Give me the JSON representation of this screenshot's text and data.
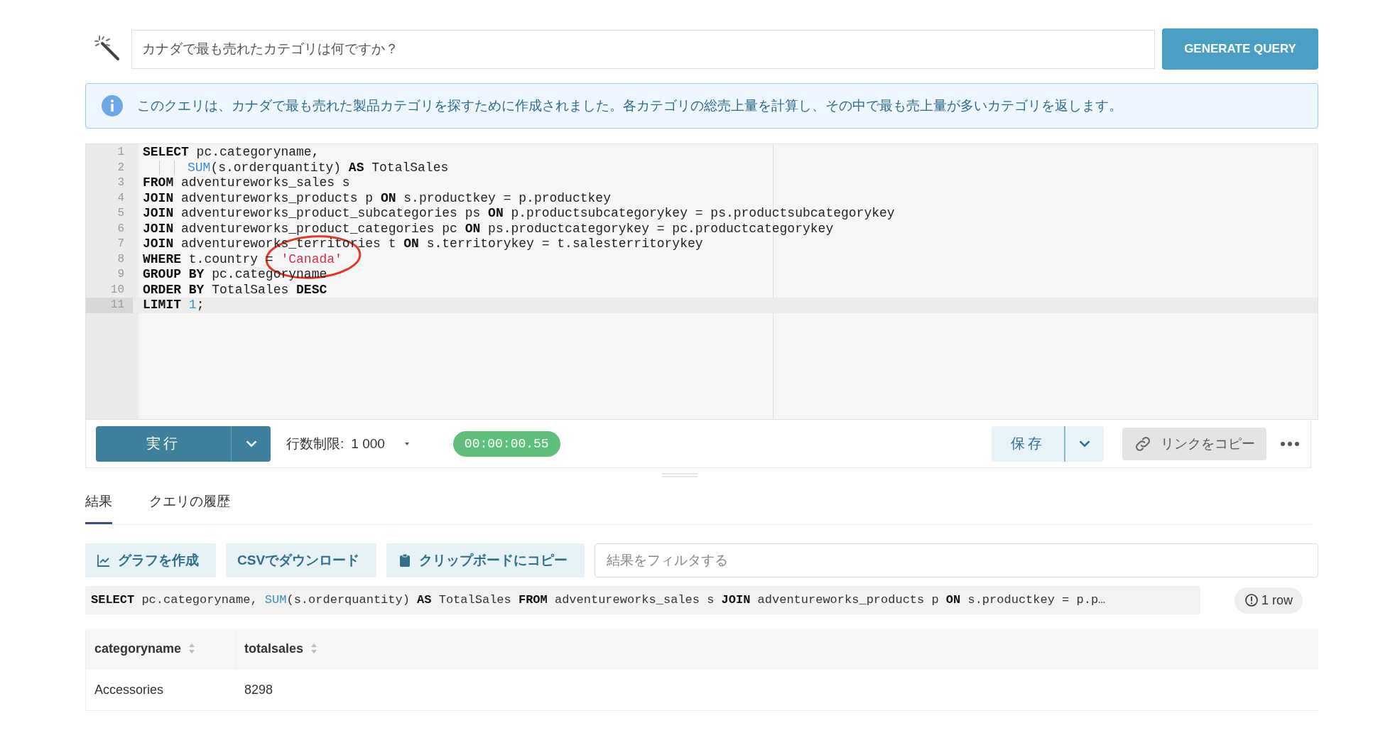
{
  "prompt": {
    "value": "カナダで最も売れたカテゴリは何ですか？",
    "button": "GENERATE QUERY"
  },
  "info": "このクエリは、カナダで最も売れた製品カテゴリを探すために作成されました。各カテゴリの総売上量を計算し、その中で最も売上量が多いカテゴリを返します。",
  "editor": {
    "lines": [
      {
        "number": "1",
        "active": false,
        "indented": false,
        "tokens": [
          {
            "kind": "keyword",
            "text": "SELECT"
          },
          {
            "kind": "plain",
            "text": " pc.categoryname,"
          }
        ]
      },
      {
        "number": "2",
        "active": false,
        "indented": true,
        "tokens": [
          {
            "kind": "function",
            "text": "SUM"
          },
          {
            "kind": "plain",
            "text": "(s.orderquantity) "
          },
          {
            "kind": "keyword",
            "text": "AS"
          },
          {
            "kind": "plain",
            "text": " TotalSales"
          }
        ]
      },
      {
        "number": "3",
        "active": false,
        "indented": false,
        "tokens": [
          {
            "kind": "keyword",
            "text": "FROM"
          },
          {
            "kind": "plain",
            "text": " adventureworks_sales s"
          }
        ]
      },
      {
        "number": "4",
        "active": false,
        "indented": false,
        "tokens": [
          {
            "kind": "keyword",
            "text": "JOIN"
          },
          {
            "kind": "plain",
            "text": " adventureworks_products p "
          },
          {
            "kind": "keyword",
            "text": "ON"
          },
          {
            "kind": "plain",
            "text": " s.productkey = p.productkey"
          }
        ]
      },
      {
        "number": "5",
        "active": false,
        "indented": false,
        "tokens": [
          {
            "kind": "keyword",
            "text": "JOIN"
          },
          {
            "kind": "plain",
            "text": " adventureworks_product_subcategories ps "
          },
          {
            "kind": "keyword",
            "text": "ON"
          },
          {
            "kind": "plain",
            "text": " p.productsubcategorykey = ps.productsubcategorykey"
          }
        ]
      },
      {
        "number": "6",
        "active": false,
        "indented": false,
        "tokens": [
          {
            "kind": "keyword",
            "text": "JOIN"
          },
          {
            "kind": "plain",
            "text": " adventureworks_product_categories pc "
          },
          {
            "kind": "keyword",
            "text": "ON"
          },
          {
            "kind": "plain",
            "text": " ps.productcategorykey = pc.productcategorykey"
          }
        ]
      },
      {
        "number": "7",
        "active": false,
        "indented": false,
        "tokens": [
          {
            "kind": "keyword",
            "text": "JOIN"
          },
          {
            "kind": "plain",
            "text": " adventureworks_territories t "
          },
          {
            "kind": "keyword",
            "text": "ON"
          },
          {
            "kind": "plain",
            "text": " s.territorykey = t.salesterritorykey"
          }
        ]
      },
      {
        "number": "8",
        "active": false,
        "indented": false,
        "tokens": [
          {
            "kind": "keyword",
            "text": "WHERE"
          },
          {
            "kind": "plain",
            "text": " t.country = "
          },
          {
            "kind": "string",
            "text": "'Canada'"
          }
        ]
      },
      {
        "number": "9",
        "active": false,
        "indented": false,
        "tokens": [
          {
            "kind": "keyword",
            "text": "GROUP BY"
          },
          {
            "kind": "plain",
            "text": " pc.categoryname"
          }
        ]
      },
      {
        "number": "10",
        "active": false,
        "indented": false,
        "tokens": [
          {
            "kind": "keyword",
            "text": "ORDER BY"
          },
          {
            "kind": "plain",
            "text": " TotalSales "
          },
          {
            "kind": "keyword",
            "text": "DESC"
          }
        ]
      },
      {
        "number": "11",
        "active": true,
        "indented": false,
        "tokens": [
          {
            "kind": "keyword",
            "text": "LIMIT "
          },
          {
            "kind": "number",
            "text": "1"
          },
          {
            "kind": "plain",
            "text": ";"
          }
        ]
      }
    ]
  },
  "toolbar": {
    "run": "実行",
    "row_limit_label": "行数制限:",
    "row_limit": "1 000",
    "elapsed": "00:00:00.55",
    "save": "保存",
    "copy_link": "リンクをコピー"
  },
  "tabs": [
    {
      "label": "結果",
      "selected": true
    },
    {
      "label": "クエリの履歴",
      "selected": false
    }
  ],
  "actions": [
    {
      "kind": "chart",
      "label": "グラフを作成"
    },
    {
      "kind": "plain",
      "label": "CSVでダウンロード"
    },
    {
      "kind": "clipboard",
      "label": "クリップボードにコピー"
    }
  ],
  "filter": {
    "placeholder": "結果をフィルタする"
  },
  "sql_preview": [
    {
      "kind": "keyword",
      "text": "SELECT"
    },
    {
      "kind": "plain",
      "text": " pc.categoryname, "
    },
    {
      "kind": "function",
      "text": "SUM"
    },
    {
      "kind": "plain",
      "text": "(s.orderquantity) "
    },
    {
      "kind": "keyword",
      "text": "AS"
    },
    {
      "kind": "plain",
      "text": " TotalSales "
    },
    {
      "kind": "keyword",
      "text": "FROM"
    },
    {
      "kind": "plain",
      "text": " adventureworks_sales s "
    },
    {
      "kind": "keyword",
      "text": "JOIN"
    },
    {
      "kind": "plain",
      "text": " adventureworks_products p "
    },
    {
      "kind": "keyword",
      "text": "ON"
    },
    {
      "kind": "plain",
      "text": " s.productkey = p.p…"
    }
  ],
  "row_count": "1 row",
  "table": {
    "columns": [
      "categoryname",
      "totalsales"
    ],
    "rows": [
      [
        "Accessories",
        "8298"
      ]
    ]
  }
}
